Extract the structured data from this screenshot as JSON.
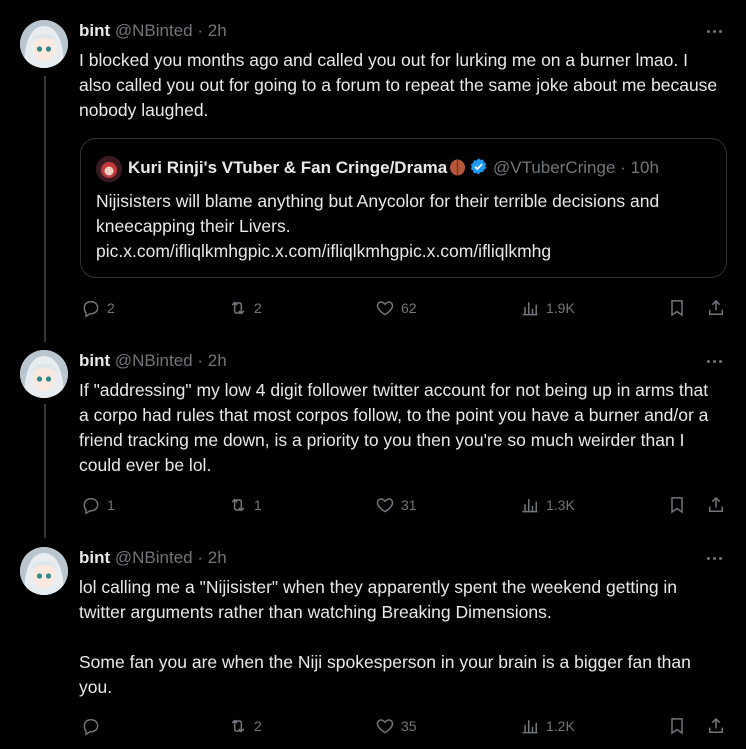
{
  "tweets": [
    {
      "name": "bint",
      "handle": "@NBinted",
      "dot": "·",
      "time": "2h",
      "text": "I blocked you months ago and called you out for lurking me on a burner lmao. I also called you out for going to a forum to repeat the same joke about me because nobody laughed.",
      "quote": {
        "name": "Kuri Rinji's VTuber & Fan Cringe/Drama",
        "handle": "@VTuberCringe",
        "dot": "·",
        "time": "10h",
        "text": "Nijisisters will blame anything but Anycolor for their terrible decisions and kneecapping their Livers.\npic.x.com/ifliqlkmhgpic.x.com/ifliqlkmhgpic.x.com/ifliqlkmhg"
      },
      "replies": "2",
      "reposts": "2",
      "likes": "62",
      "views": "1.9K"
    },
    {
      "name": "bint",
      "handle": "@NBinted",
      "dot": "·",
      "time": "2h",
      "text": "If \"addressing\" my low 4 digit follower twitter account for not being up in arms that a corpo had rules that most corpos follow, to the point you have a burner and/or a friend tracking me down, is a priority to you then you're so much weirder than I could ever be lol.",
      "replies": "1",
      "reposts": "1",
      "likes": "31",
      "views": "1.3K"
    },
    {
      "name": "bint",
      "handle": "@NBinted",
      "dot": "·",
      "time": "2h",
      "text": "lol calling me a \"Nijisister\" when they apparently spent the weekend getting in twitter arguments rather than watching Breaking Dimensions.\n\nSome fan you are when the Niji spokesperson in your brain is a bigger fan than you.",
      "replies": "",
      "reposts": "2",
      "likes": "35",
      "views": "1.2K"
    }
  ],
  "icons": {
    "reply": "reply-icon",
    "repost": "repost-icon",
    "like": "heart-icon",
    "views": "views-icon",
    "bookmark": "bookmark-icon",
    "share": "share-icon",
    "more": "more-icon",
    "verified": "verified-icon"
  },
  "colors": {
    "background": "#000000",
    "text": "#e7e9ea",
    "muted": "#71767b",
    "verified": "#1d9bf0",
    "border": "#2f3336"
  }
}
